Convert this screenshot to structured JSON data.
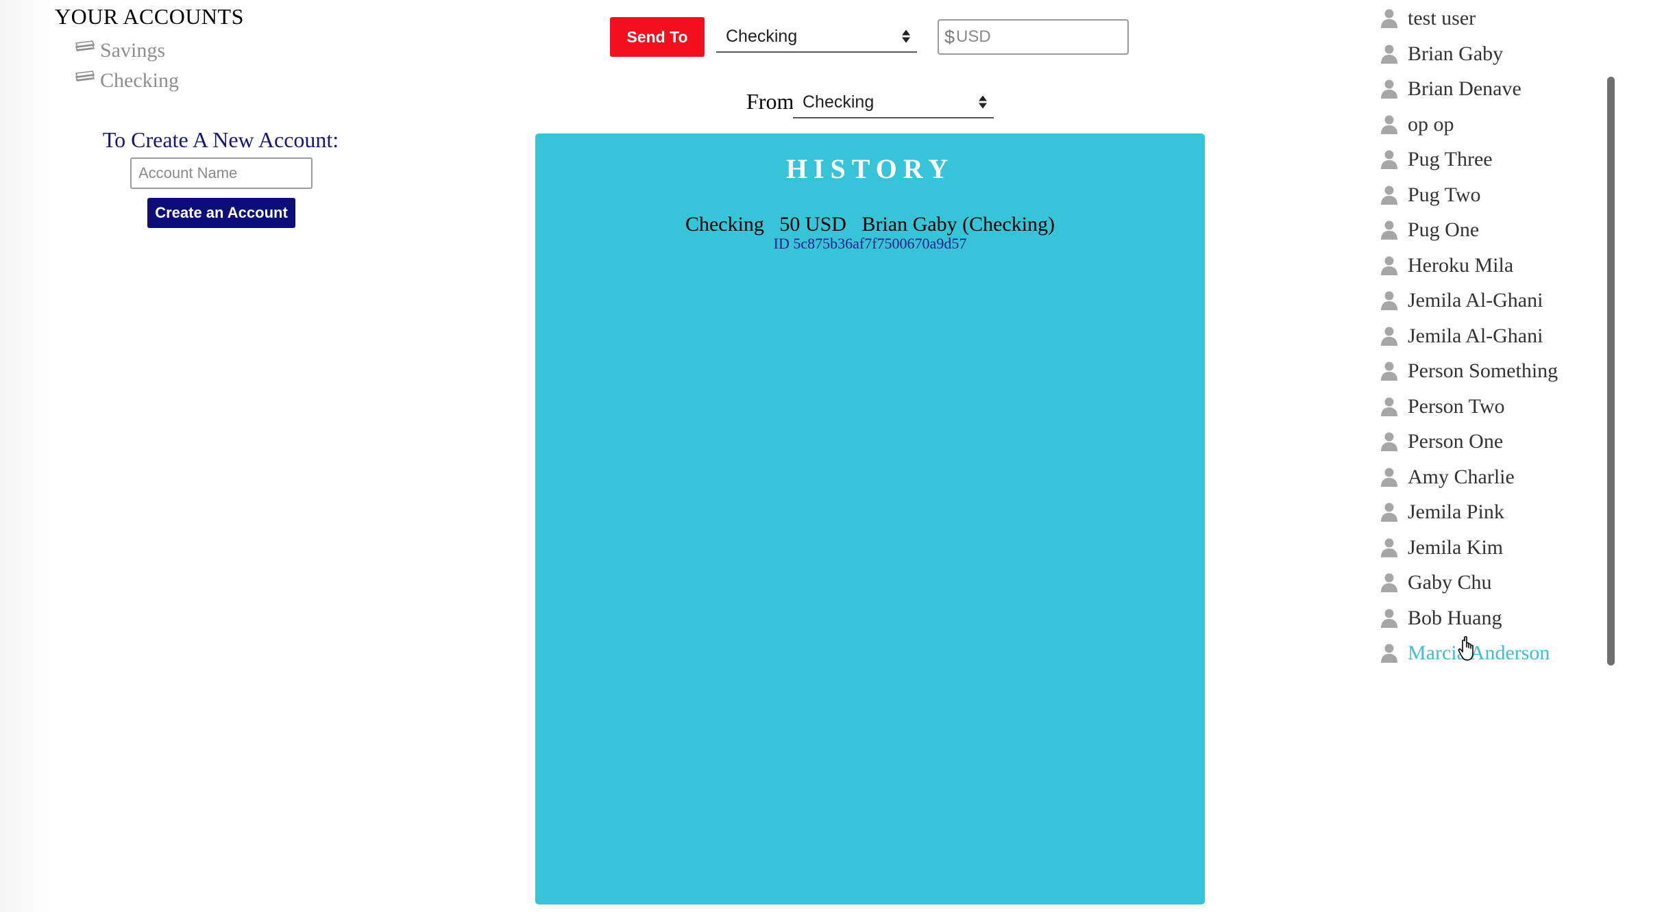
{
  "accounts": {
    "heading": "YOUR ACCOUNTS",
    "items": [
      {
        "label": "Savings",
        "icon": "cash-icon"
      },
      {
        "label": "Checking",
        "icon": "cash-icon"
      }
    ]
  },
  "create_account": {
    "heading": "To Create A New Account:",
    "input_placeholder": "Account Name",
    "button_label": "Create an Account"
  },
  "transfer": {
    "send_button_label": "Send To",
    "to_account_selected": "Checking",
    "amount_prefix": "$",
    "amount_placeholder": "USD",
    "from_label": "From",
    "from_account_selected": "Checking"
  },
  "history": {
    "title": "HISTORY",
    "entries": [
      {
        "summary": "Checking   50 USD   Brian Gaby (Checking)",
        "id_label": "ID 5c875b36af7f7500670a9d57"
      }
    ]
  },
  "users": {
    "items": [
      "test user",
      "Brian Gaby",
      "Brian Denave",
      "op op",
      "Pug Three",
      "Pug Two",
      "Pug One",
      "Heroku Mila",
      "Jemila Al-Ghani",
      "Jemila Al-Ghani",
      "Person Something",
      "Person Two",
      "Person One",
      "Amy Charlie",
      "Jemila Pink",
      "Jemila Kim",
      "Gaby Chu",
      "Bob Huang",
      "Marcia Anderson"
    ],
    "hovered_index": 18,
    "icon": "user-icon"
  },
  "colors": {
    "send_button": "#f2101e",
    "create_button": "#0d0d7a",
    "history_panel": "#38c4d8",
    "hovered_user": "#3cbfd6"
  }
}
